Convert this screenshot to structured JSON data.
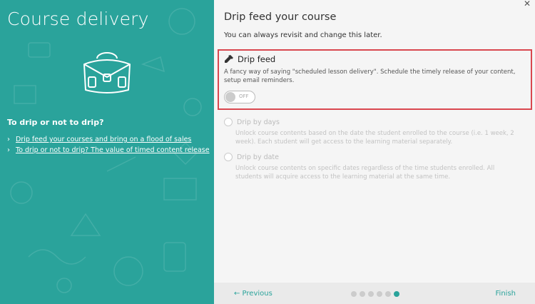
{
  "left_panel": {
    "title": "Course delivery",
    "subtitle": "To drip or not to drip?",
    "links": [
      {
        "label": "Drip feed your courses and bring on a flood of sales"
      },
      {
        "label": "To drip or not to drip? The value of timed content release"
      }
    ],
    "background_color": "#2aa39b"
  },
  "dialog": {
    "close_icon": "close-icon",
    "heading": "Drip feed your course",
    "subheading": "You can always revisit and change this later.",
    "drip_feed": {
      "icon": "dropper-icon",
      "title": "Drip feed",
      "description": "A fancy way of saying \"scheduled lesson delivery\". Schedule the timely release of your content, setup email reminders.",
      "toggle_label": "OFF",
      "toggle_state": "off"
    },
    "options": [
      {
        "label": "Drip by days",
        "description": "Unlock course contents based on the date the student enrolled to the course (i.e. 1 week, 2 week). Each student will get access to the learning material separately."
      },
      {
        "label": "Drip by date",
        "description": "Unlock course contents on specific dates regardless of the time students enrolled. All students will acquire access to the learning material at the same time."
      }
    ],
    "highlight_color": "#d9474f"
  },
  "footer": {
    "previous_label": "← Previous",
    "finish_label": "Finish",
    "steps_total": 6,
    "current_step": 6
  }
}
